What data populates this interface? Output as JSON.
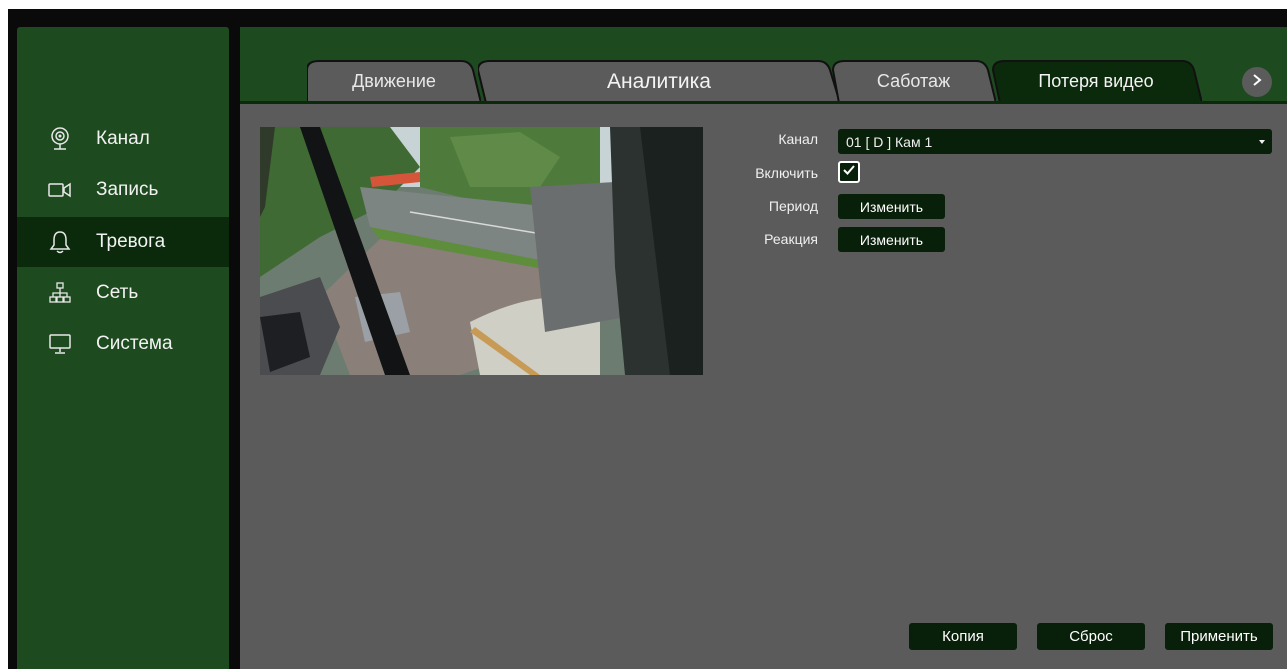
{
  "sidebar": {
    "items": [
      {
        "label": "Канал",
        "icon": "camera-lens-icon"
      },
      {
        "label": "Запись",
        "icon": "video-camera-icon"
      },
      {
        "label": "Тревога",
        "icon": "bell-icon",
        "active": true
      },
      {
        "label": "Сеть",
        "icon": "network-icon"
      },
      {
        "label": "Система",
        "icon": "monitor-icon"
      }
    ]
  },
  "tabs": [
    {
      "label": "Движение"
    },
    {
      "label": "Аналитика"
    },
    {
      "label": "Саботаж"
    },
    {
      "label": "Потеря видео",
      "active": true
    }
  ],
  "form": {
    "channel_label": "Канал",
    "channel_value": "01 [ D ] Кам 1",
    "enable_label": "Включить",
    "enable_checked": true,
    "period_label": "Период",
    "period_button": "Изменить",
    "reaction_label": "Реакция",
    "reaction_button": "Изменить"
  },
  "footer": {
    "copy": "Копия",
    "reset": "Сброс",
    "apply": "Применить"
  },
  "colors": {
    "panel_green": "#1e4a1f",
    "dark_green": "#0b2a0c",
    "content_gray": "#5b5b5b"
  }
}
